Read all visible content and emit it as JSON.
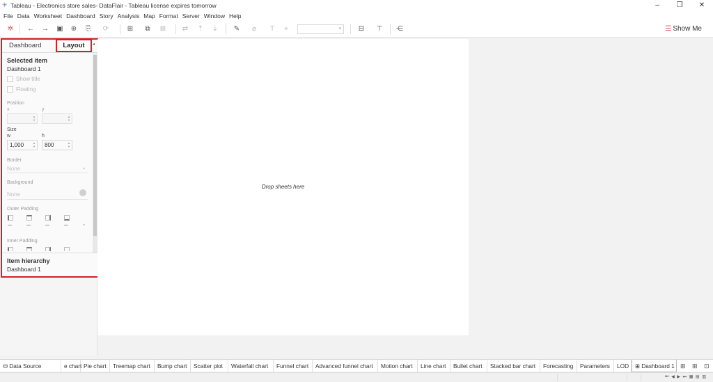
{
  "window": {
    "title": "Tableau - Electronics store sales- DataFlair - Tableau license expires tomorrow",
    "icon": "tableau-logo-icon",
    "controls": {
      "minimize": "–",
      "restore": "❐",
      "close": "✕"
    }
  },
  "menu": [
    "File",
    "Data",
    "Worksheet",
    "Dashboard",
    "Story",
    "Analysis",
    "Map",
    "Format",
    "Server",
    "Window",
    "Help"
  ],
  "toolbar": {
    "show_me_label": "Show Me",
    "icons": [
      "tableau-logo-icon",
      "undo-icon",
      "redo-icon",
      "save-icon",
      "new-data-source-icon",
      "pause-updates-icon",
      "refresh-icon",
      "new-worksheet-icon",
      "duplicate-icon",
      "clear-icon",
      "swap-icon",
      "sort-ascending-icon",
      "sort-descending-icon",
      "highlight-icon",
      "group-icon",
      "labels-icon",
      "fix-axes-icon",
      "fit-dropdown",
      "show-cards-icon",
      "presentation-mode-icon",
      "share-icon"
    ]
  },
  "left_panel": {
    "tabs": {
      "dashboard": "Dashboard",
      "layout": "Layout"
    },
    "selected_item": {
      "heading": "Selected item",
      "value": "Dashboard 1"
    },
    "show_title_label": "Show title",
    "floating_label": "Floating",
    "position": {
      "label": "Position",
      "x_label": "x",
      "y_label": "y",
      "x_value": "",
      "y_value": ""
    },
    "size": {
      "label": "Size",
      "w_label": "w",
      "h_label": "h",
      "w_value": "1,000",
      "h_value": "800"
    },
    "border": {
      "label": "Border",
      "value": "None"
    },
    "background": {
      "label": "Background",
      "value": "None"
    },
    "outer_padding_label": "Outer Padding",
    "inner_padding_label": "Inner Padding",
    "item_hierarchy": {
      "heading": "Item hierarchy",
      "value": "Dashboard 1"
    }
  },
  "canvas": {
    "placeholder": "Drop sheets here"
  },
  "sheet_tabs": {
    "data_source": "Data Source",
    "tabs": [
      "e chart",
      "Pie chart",
      "Treemap chart",
      "Bump chart",
      "Scatter plot",
      "Waterfall chart",
      "Funnel chart",
      "Advanced funnel chart",
      "Motion chart",
      "Line chart",
      "Bullet chart",
      "Stacked bar chart",
      "Forecasting",
      "Parameters",
      "LOD"
    ],
    "active_tab": "Dashboard 1"
  },
  "colors": {
    "highlight_red": "#d21f26",
    "canvas": "#ffffff",
    "workspace": "#f2f2f2"
  }
}
